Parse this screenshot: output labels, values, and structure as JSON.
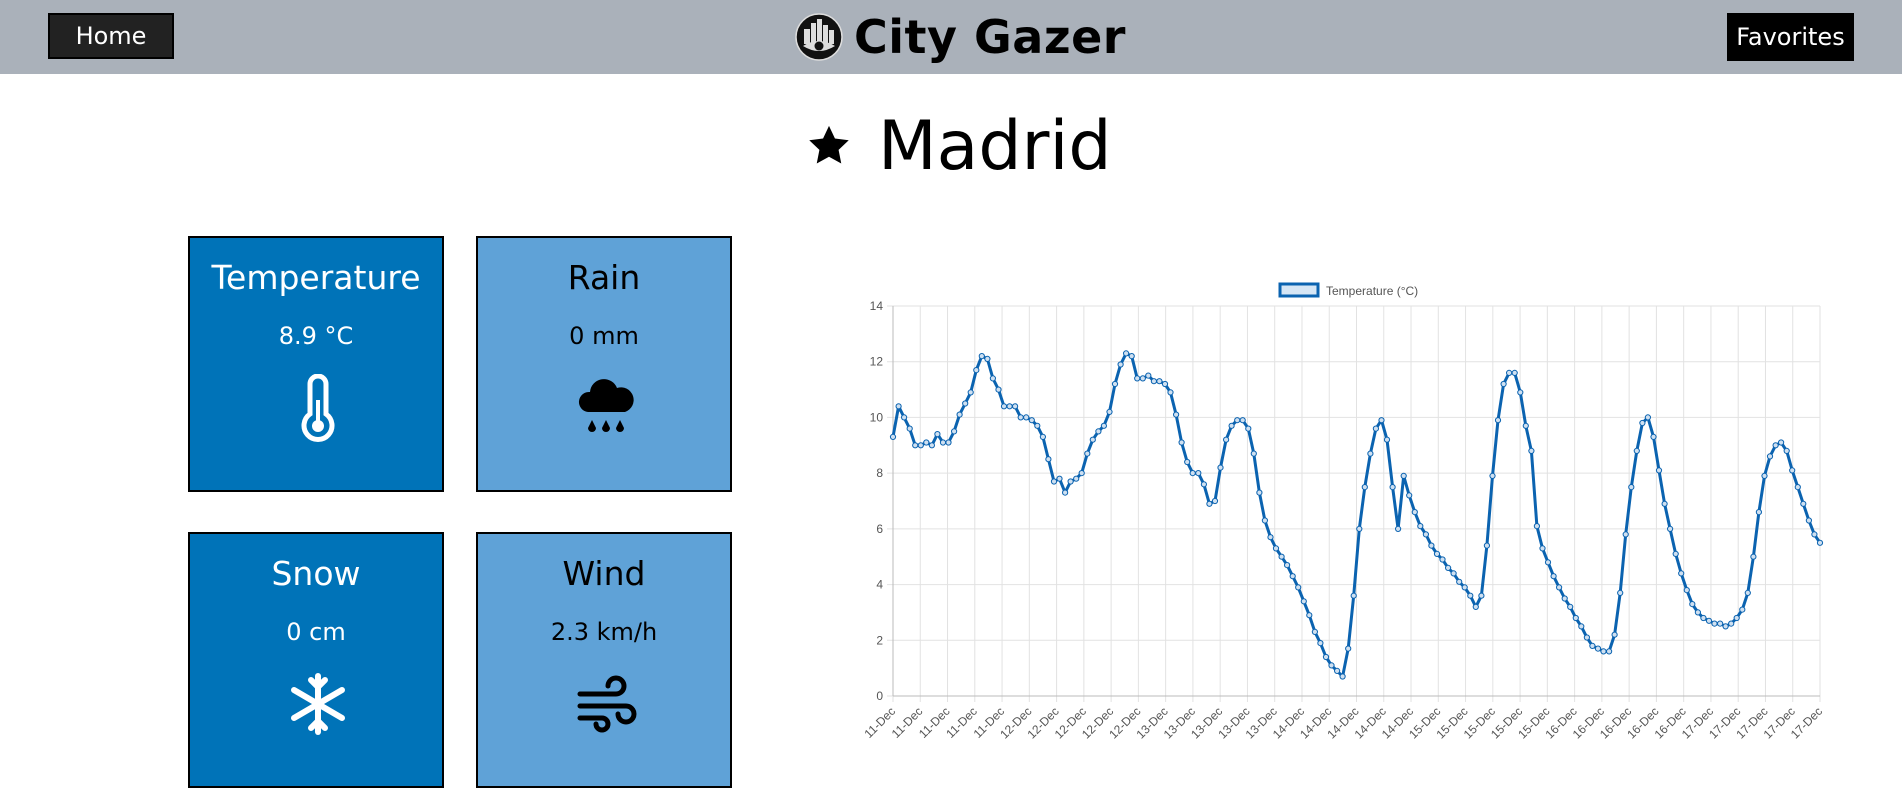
{
  "nav": {
    "home_label": "Home",
    "favorites_label": "Favorites"
  },
  "brand": {
    "name": "City Gazer",
    "logo_icon": "city-eye-logo"
  },
  "city": {
    "name": "Madrid",
    "favorite_icon": "star-icon"
  },
  "tiles": {
    "temperature": {
      "title": "Temperature",
      "value": "8.9 °C",
      "icon": "thermometer-icon"
    },
    "rain": {
      "title": "Rain",
      "value": "0 mm",
      "icon": "rain-cloud-icon"
    },
    "snow": {
      "title": "Snow",
      "value": "0 cm",
      "icon": "snowflake-icon"
    },
    "wind": {
      "title": "Wind",
      "value": "2.3 km/h",
      "icon": "wind-icon"
    }
  },
  "colors": {
    "header_bg": "#aab1ba",
    "tile_dark": "#0073b8",
    "tile_light": "#5fa2d7",
    "series": "#0b63b0"
  },
  "chart_data": {
    "type": "line",
    "legend": "Temperature (°C)",
    "legend_position": "top",
    "grid": true,
    "ylim": [
      0,
      14
    ],
    "yticks": [
      0,
      2,
      4,
      6,
      8,
      10,
      12,
      14
    ],
    "xtick_labels": [
      "11-Dec",
      "11-Dec",
      "11-Dec",
      "11-Dec",
      "11-Dec",
      "12-Dec",
      "12-Dec",
      "12-Dec",
      "12-Dec",
      "12-Dec",
      "13-Dec",
      "13-Dec",
      "13-Dec",
      "13-Dec",
      "13-Dec",
      "14-Dec",
      "14-Dec",
      "14-Dec",
      "14-Dec",
      "14-Dec",
      "15-Dec",
      "15-Dec",
      "15-Dec",
      "15-Dec",
      "15-Dec",
      "16-Dec",
      "16-Dec",
      "16-Dec",
      "16-Dec",
      "16-Dec",
      "17-Dec",
      "17-Dec",
      "17-Dec",
      "17-Dec",
      "17-Dec"
    ],
    "series": [
      {
        "name": "Temperature (°C)",
        "values": [
          9.3,
          10.4,
          10.0,
          9.6,
          9.0,
          9.0,
          9.1,
          9.0,
          9.4,
          9.1,
          9.1,
          9.5,
          10.1,
          10.5,
          10.9,
          11.7,
          12.2,
          12.1,
          11.4,
          11.0,
          10.4,
          10.4,
          10.4,
          10.0,
          10.0,
          9.9,
          9.7,
          9.3,
          8.5,
          7.7,
          7.8,
          7.3,
          7.7,
          7.8,
          8.0,
          8.7,
          9.2,
          9.5,
          9.7,
          10.2,
          11.2,
          11.9,
          12.3,
          12.2,
          11.4,
          11.4,
          11.5,
          11.3,
          11.3,
          11.2,
          10.9,
          10.1,
          9.1,
          8.4,
          8.0,
          8.0,
          7.6,
          6.9,
          7.0,
          8.2,
          9.2,
          9.7,
          9.9,
          9.9,
          9.6,
          8.7,
          7.3,
          6.3,
          5.7,
          5.3,
          5.0,
          4.7,
          4.3,
          3.9,
          3.4,
          2.9,
          2.3,
          1.9,
          1.4,
          1.1,
          0.9,
          0.7,
          1.7,
          3.6,
          6.0,
          7.5,
          8.7,
          9.6,
          9.9,
          9.2,
          7.5,
          6.0,
          7.9,
          7.2,
          6.6,
          6.1,
          5.8,
          5.4,
          5.1,
          4.9,
          4.6,
          4.4,
          4.1,
          3.9,
          3.6,
          3.2,
          3.6,
          5.4,
          7.9,
          9.9,
          11.2,
          11.6,
          11.6,
          10.9,
          9.7,
          8.8,
          6.1,
          5.3,
          4.8,
          4.3,
          3.9,
          3.5,
          3.2,
          2.8,
          2.5,
          2.1,
          1.8,
          1.7,
          1.6,
          1.6,
          2.2,
          3.7,
          5.8,
          7.5,
          8.8,
          9.8,
          10.0,
          9.3,
          8.1,
          6.9,
          6.0,
          5.1,
          4.4,
          3.8,
          3.3,
          3.0,
          2.8,
          2.7,
          2.6,
          2.6,
          2.5,
          2.6,
          2.8,
          3.1,
          3.7,
          5.0,
          6.6,
          7.9,
          8.6,
          9.0,
          9.1,
          8.8,
          8.1,
          7.5,
          6.9,
          6.3,
          5.8,
          5.5
        ]
      }
    ]
  }
}
